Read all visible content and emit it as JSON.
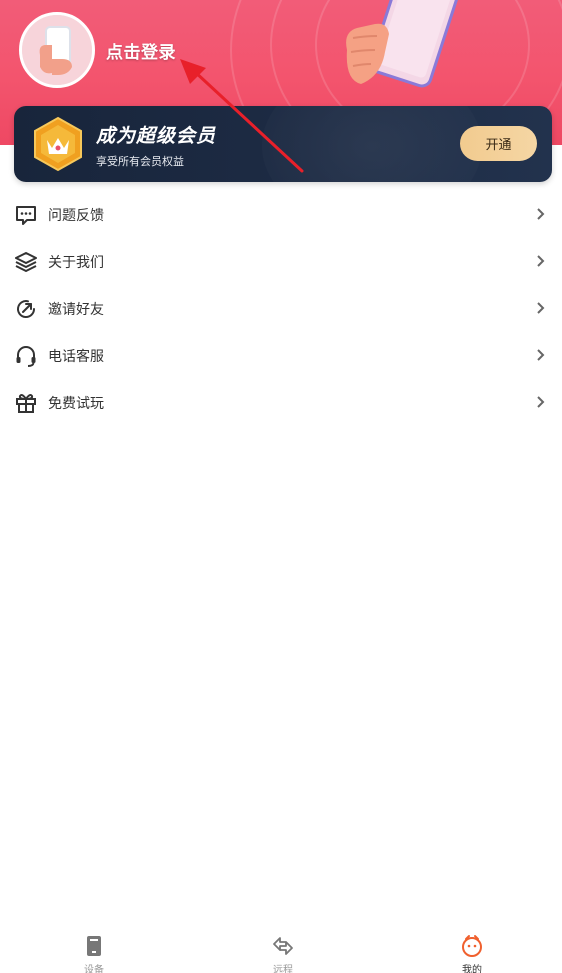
{
  "header": {
    "login_text": "点击登录"
  },
  "vip": {
    "title": "成为超级会员",
    "subtitle": "享受所有会员权益",
    "button_label": "开通"
  },
  "menu": {
    "items": [
      {
        "label": "问题反馈",
        "icon": "feedback-icon"
      },
      {
        "label": "关于我们",
        "icon": "layers-icon"
      },
      {
        "label": "邀请好友",
        "icon": "share-icon"
      },
      {
        "label": "电话客服",
        "icon": "headset-icon"
      },
      {
        "label": "免费试玩",
        "icon": "gift-icon"
      }
    ]
  },
  "bottom_nav": {
    "items": [
      {
        "label": "设备",
        "icon": "device-icon",
        "active": false
      },
      {
        "label": "远程",
        "icon": "remote-icon",
        "active": false
      },
      {
        "label": "我的",
        "icon": "profile-icon",
        "active": true
      }
    ]
  },
  "colors": {
    "header_pink": "#f3546d",
    "banner_navy": "#1d2b44",
    "button_gold": "#f2cb8f",
    "active_orange": "#f0602e",
    "arrow_red": "#e8202a"
  }
}
